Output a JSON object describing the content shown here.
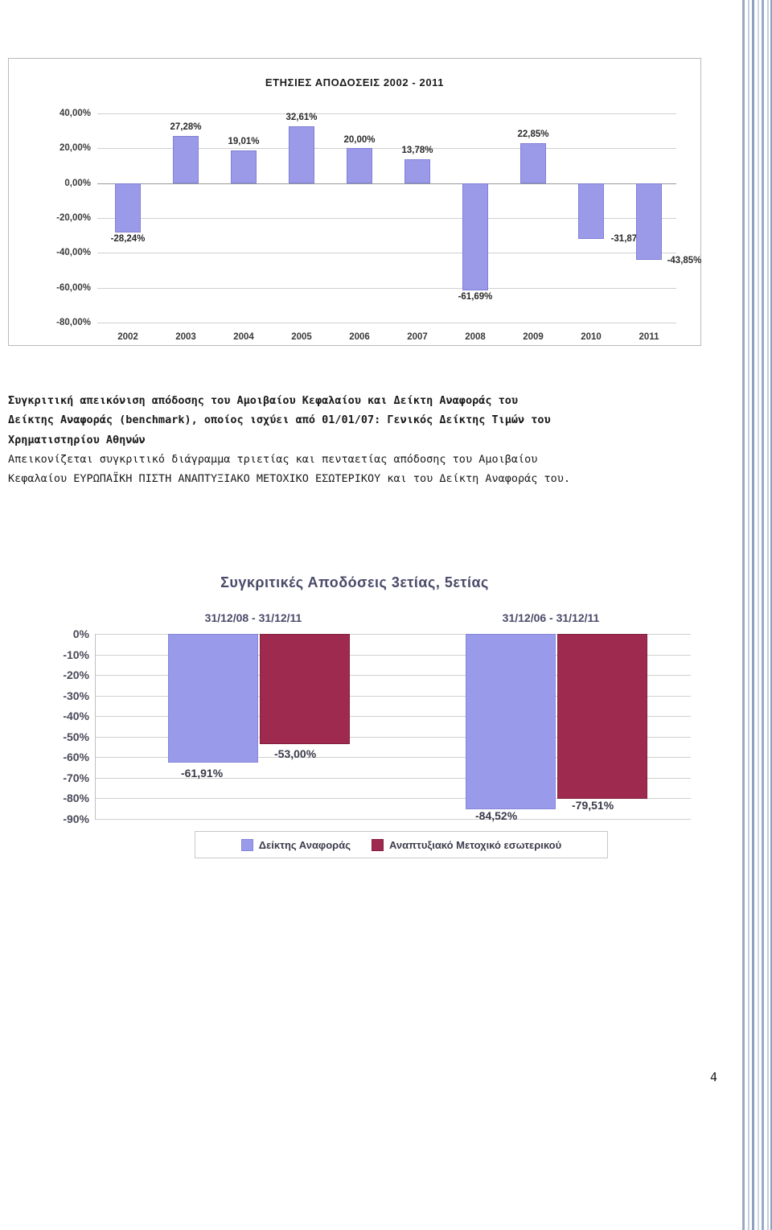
{
  "page": {
    "number": "4"
  },
  "text_block": {
    "line1": "Συγκριτική απεικόνιση απόδοσης του Αμοιβαίου Κεφαλαίου και Δείκτη Αναφοράς του",
    "line2": "Δείκτης Αναφοράς (benchmark), οποίος ισχύει από 01/01/07: Γενικός Δείκτης Τιμών του",
    "line3": "Χρηματιστηρίου Αθηνών",
    "line4": "Απεικονίζεται συγκριτικό διάγραμμα τριετίας και πενταετίας απόδοσης του Αμοιβαίου",
    "line5": "Κεφαλαίου ΕΥΡΩΠΑΪΚΗ ΠΙΣΤΗ ΑΝΑΠΤΥΞΙΑΚΟ ΜΕΤΟΧΙΚΟ ΕΣΩΤΕΡΙΚΟΥ και του Δείκτη Αναφοράς του."
  },
  "chart_data": [
    {
      "type": "bar",
      "title": "ΕΤΗΣΙΕΣ ΑΠΟΔΟΣΕΙΣ 2002 - 2011",
      "xlabel": "",
      "ylabel": "",
      "ylim": [
        -80,
        40
      ],
      "grid": true,
      "legend": "none",
      "bar_color": "#9a9ae8",
      "categories": [
        "2002",
        "2003",
        "2004",
        "2005",
        "2006",
        "2007",
        "2008",
        "2009",
        "2010",
        "2011"
      ],
      "values": [
        -28.24,
        27.28,
        19.01,
        32.61,
        20.0,
        13.78,
        -61.69,
        22.85,
        -31.87,
        -43.85
      ],
      "data_labels": [
        "-28,24%",
        "27,28%",
        "19,01%",
        "32,61%",
        "20,00%",
        "13,78%",
        "-61,69%",
        "22,85%",
        "-31,87%",
        "-43,85%"
      ],
      "ytick_labels": [
        "40,00%",
        "20,00%",
        "0,00%",
        "-20,00%",
        "-40,00%",
        "-60,00%",
        "-80,00%"
      ],
      "ytick_values": [
        40,
        20,
        0,
        -20,
        -40,
        -60,
        -80
      ]
    },
    {
      "type": "bar",
      "title": "Συγκριτικές Αποδόσεις 3ετίας, 5ετίας",
      "xlabel": "",
      "ylabel": "",
      "ylim": [
        -90,
        0
      ],
      "grid": true,
      "legend": "bottom",
      "categories": [
        "31/12/08 - 31/12/11",
        "31/12/06 - 31/12/11"
      ],
      "series": [
        {
          "name": "Δείκτης Αναφοράς",
          "color": "#9a9aea",
          "values": [
            -61.91,
            -84.52
          ],
          "data_labels": [
            "-61,91%",
            "-84,52%"
          ]
        },
        {
          "name": "Αναπτυξιακό Μετοχικό εσωτερικού",
          "color": "#9e2a4f",
          "values": [
            -53.0,
            -79.51
          ],
          "data_labels": [
            "-53,00%",
            "-79,51%"
          ]
        }
      ],
      "ytick_labels": [
        "0%",
        "-10%",
        "-20%",
        "-30%",
        "-40%",
        "-50%",
        "-60%",
        "-70%",
        "-80%",
        "-90%"
      ],
      "ytick_values": [
        0,
        -10,
        -20,
        -30,
        -40,
        -50,
        -60,
        -70,
        -80,
        -90
      ]
    }
  ]
}
